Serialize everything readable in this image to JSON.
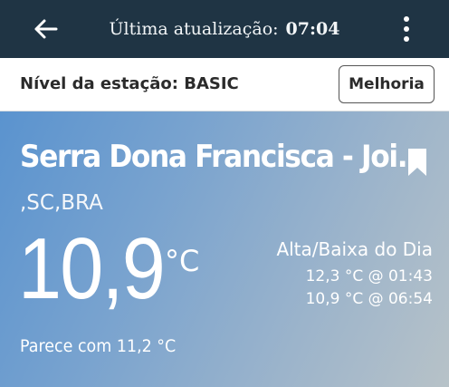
{
  "header": {
    "update_label": "Última atualização:",
    "update_time": "07:04",
    "back_icon": "arrow-left-icon",
    "menu_icon": "more-vertical-icon"
  },
  "station_bar": {
    "level_text": "Nível da estação: BASIC",
    "upgrade_label": "Melhoria"
  },
  "weather": {
    "station_name": "Serra Dona Francisca - Joi...",
    "location": ",SC,BRA",
    "temperature": "10,9",
    "unit": "°C",
    "feels_like": "Parece com 11,2 °C",
    "hilo_title": "Alta/Baixa do Dia",
    "high": "12,3 °C @ 01:43",
    "low": "10,9 °C @ 06:54",
    "bookmark_icon": "bookmark-icon"
  },
  "colors": {
    "topbar": "#1f3444",
    "hero_start": "#5a93cf",
    "hero_end": "#b7c2c8"
  }
}
